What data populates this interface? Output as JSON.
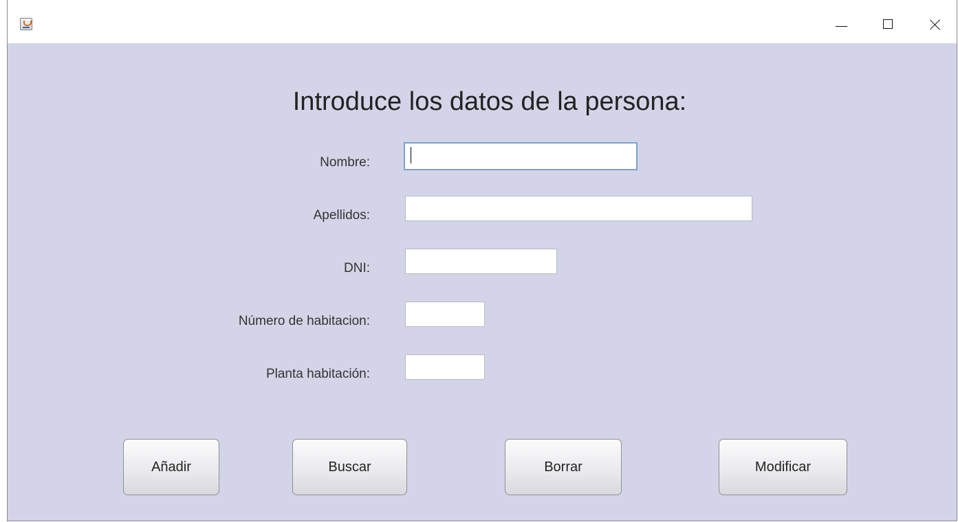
{
  "form": {
    "title": "Introduce los datos de la persona:",
    "fields": {
      "nombre": {
        "label": "Nombre:",
        "value": ""
      },
      "apellidos": {
        "label": "Apellidos:",
        "value": ""
      },
      "dni": {
        "label": "DNI:",
        "value": ""
      },
      "numero_habitacion": {
        "label": "Número de habitacion:",
        "value": ""
      },
      "planta_habitacion": {
        "label": "Planta habitación:",
        "value": ""
      }
    }
  },
  "buttons": {
    "anadir": "Añadir",
    "buscar": "Buscar",
    "borrar": "Borrar",
    "modificar": "Modificar"
  },
  "icons": {
    "app": "java-app-icon",
    "minimize": "minimize-icon",
    "maximize": "maximize-icon",
    "close": "close-icon"
  },
  "colors": {
    "content_background": "#d4d4e8",
    "titlebar_background": "#ffffff",
    "focus_border": "#7ea1c9"
  }
}
